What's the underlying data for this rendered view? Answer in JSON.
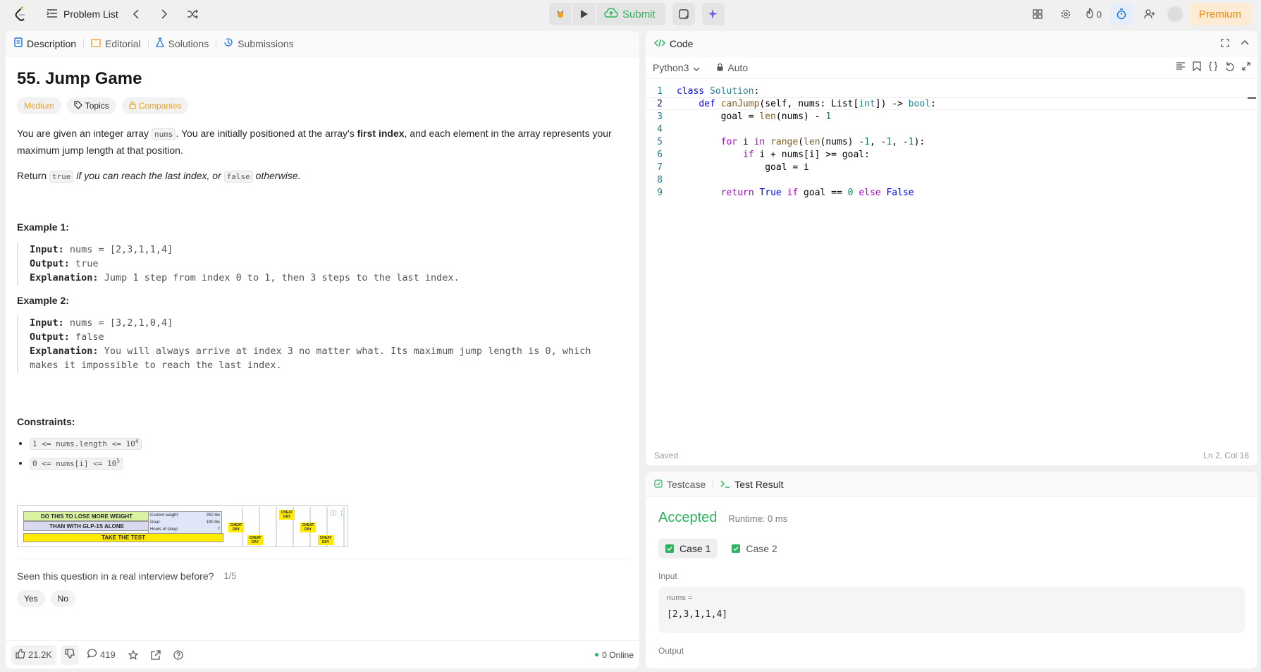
{
  "topbar": {
    "problem_list": "Problem List",
    "submit": "Submit",
    "streak_count": "0",
    "premium": "Premium"
  },
  "description": {
    "tabs": [
      "Description",
      "Editorial",
      "Solutions",
      "Submissions"
    ],
    "title": "55. Jump Game",
    "tags": {
      "difficulty": "Medium",
      "topics": "Topics",
      "companies": "Companies"
    },
    "p1_a": "You are given an integer array ",
    "p1_code": "nums",
    "p1_b": ". You are initially positioned at the array's ",
    "p1_bold": "first index",
    "p1_c": ", and each element in the array represents your maximum jump length at that position.",
    "p2_a": "Return ",
    "p2_code1": "true",
    "p2_b": " if you can reach the last index, or ",
    "p2_code2": "false",
    "p2_c": " otherwise.",
    "example1": {
      "title": "Example 1:",
      "input_label": "Input:",
      "input": "nums = [2,3,1,1,4]",
      "output_label": "Output:",
      "output": "true",
      "expl_label": "Explanation:",
      "expl": "Jump 1 step from index 0 to 1, then 3 steps to the last index."
    },
    "example2": {
      "title": "Example 2:",
      "input_label": "Input:",
      "input": "nums = [3,2,1,0,4]",
      "output_label": "Output:",
      "output": "false",
      "expl_label": "Explanation:",
      "expl1": "You will always arrive at index 3 no matter what. Its maximum jump length is 0, which",
      "expl2": "makes it impossible to reach the last index."
    },
    "constraints_title": "Constraints:",
    "constraint1": "1 <= nums.length <= 10",
    "constraint1_sup": "4",
    "constraint2": "0 <= nums[i] <= 10",
    "constraint2_sup": "5",
    "ad": {
      "headline1": "DO THIS TO LOSE MORE WEIGHT",
      "headline2": "THAN WITH GLP-1S ALONE",
      "cta": "TAKE THE TEST",
      "row1_label": "Current weight:",
      "row1_val": "250 lbs",
      "row2_label": "Goal:",
      "row2_val": "190 lbs",
      "row3_label": "Hours of sleep:",
      "row3_val": "7",
      "cheat": "CHEAT DAY"
    },
    "interview_q": "Seen this question in a real interview before?",
    "interview_count": "1/5",
    "yes": "Yes",
    "no": "No",
    "footer": {
      "likes": "21.2K",
      "comments": "419",
      "online": "0 Online"
    }
  },
  "code": {
    "header": "Code",
    "language": "Python3",
    "mode": "Auto",
    "status_left": "Saved",
    "status_right": "Ln 2, Col 16"
  },
  "result": {
    "tabs": [
      "Testcase",
      "Test Result"
    ],
    "status": "Accepted",
    "runtime": "Runtime: 0 ms",
    "cases": [
      "Case 1",
      "Case 2"
    ],
    "input_label": "Input",
    "param": "nums =",
    "value": "[2,3,1,1,4]",
    "output_label": "Output"
  },
  "colors": {
    "accent_green": "#2db55d",
    "premium": "#e88a14",
    "medium": "#f0a020"
  }
}
